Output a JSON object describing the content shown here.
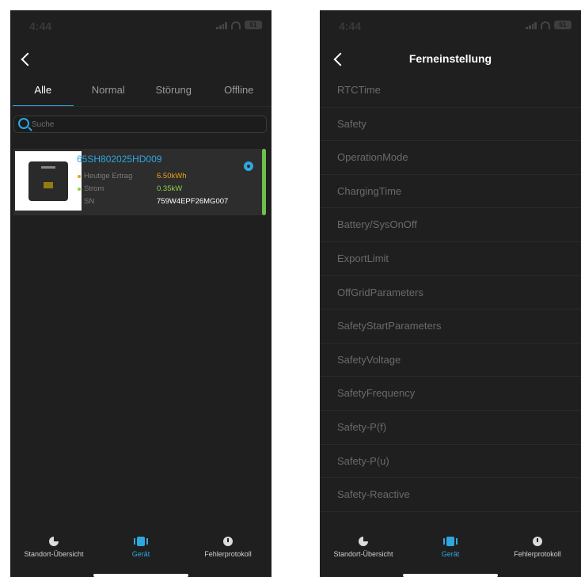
{
  "left": {
    "status": {
      "time": "4:44",
      "battery": "61"
    },
    "tabs": [
      "Alle",
      "Normal",
      "Störung",
      "Offline"
    ],
    "search": {
      "placeholder": "Suche"
    },
    "device": {
      "name": "65SH802025HD009",
      "rows": [
        {
          "label": "Heutige Ertrag",
          "value": "6.50kWh",
          "color": "#e8a319"
        },
        {
          "label": "Strom",
          "value": "0.35kW",
          "color": "#8fcd4f"
        },
        {
          "label": "SN",
          "value": "759W4EPF26MG007",
          "color": "#ffffff"
        }
      ],
      "brand": "Energizer",
      "status_color": "#6dc04b"
    },
    "nav": [
      "Standort-Übersicht",
      "Gerät",
      "Fehlerprotokoll"
    ]
  },
  "right": {
    "status": {
      "time": "4:44",
      "battery": "61"
    },
    "title": "Ferneinstellung",
    "items": [
      "RTCTime",
      "Safety",
      "OperationMode",
      "ChargingTime",
      "Battery/SysOnOff",
      "ExportLimit",
      "OffGridParameters",
      "SafetyStartParameters",
      "SafetyVoltage",
      "SafetyFrequency",
      "Safety-P(f)",
      "Safety-P(u)",
      "Safety-Reactive"
    ],
    "nav": [
      "Standort-Übersicht",
      "Gerät",
      "Fehlerprotokoll"
    ]
  },
  "colors": {
    "accent": "#2da7e0",
    "background": "#1f1f1f",
    "card": "#2d2d2d"
  }
}
